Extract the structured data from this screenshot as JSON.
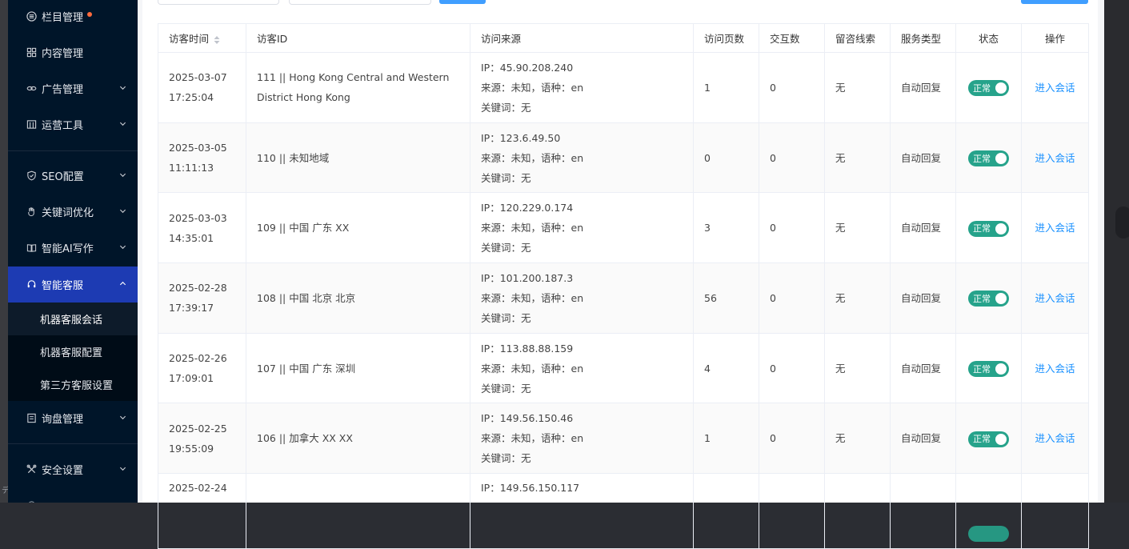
{
  "sidebar": {
    "items": [
      {
        "label": "栏目管理",
        "icon": "list-icon",
        "has_dot": true
      },
      {
        "label": "内容管理",
        "icon": "grid-icon"
      },
      {
        "label": "广告管理",
        "icon": "link-icon"
      },
      {
        "label": "运营工具",
        "icon": "tool-icon"
      },
      {
        "label": "SEO配置",
        "icon": "shield-icon"
      },
      {
        "label": "关键词优化",
        "icon": "hand-icon"
      },
      {
        "label": "智能AI写作",
        "icon": "book-icon"
      },
      {
        "label": "智能客服",
        "icon": "headset-icon"
      },
      {
        "label": "询盘管理",
        "icon": "inbox-icon"
      },
      {
        "label": "安全设置",
        "icon": "wrench-icon"
      }
    ],
    "sub_items": [
      {
        "label": "机器客服会话"
      },
      {
        "label": "机器客服配置"
      },
      {
        "label": "第三方客服设置"
      }
    ]
  },
  "table": {
    "headers": {
      "visit_time": "访客时间",
      "visitor_id": "访客ID",
      "source": "访问来源",
      "pages": "访问页数",
      "interactions": "交互数",
      "leads": "留咨线索",
      "service_type": "服务类型",
      "status": "状态",
      "action": "操作"
    },
    "rows": [
      {
        "date": "2025-03-07",
        "time": "17:25:04",
        "id_line1": "111 || Hong Kong Central and Western",
        "id_line2": "District Hong Kong",
        "ip": "IP：45.90.208.240",
        "from": "来源：未知，语种：en",
        "keyword": "关键词：无",
        "pages": "1",
        "interactions": "0",
        "leads": "无",
        "service": "自动回复",
        "status": "正常",
        "action": "进入会话"
      },
      {
        "date": "2025-03-05",
        "time": "11:11:13",
        "id_line1": "110 || 未知地域",
        "id_line2": "",
        "ip": "IP：123.6.49.50",
        "from": "来源：未知，语种：en",
        "keyword": "关键词：无",
        "pages": "0",
        "interactions": "0",
        "leads": "无",
        "service": "自动回复",
        "status": "正常",
        "action": "进入会话"
      },
      {
        "date": "2025-03-03",
        "time": "14:35:01",
        "id_line1": "109 || 中国 广东 XX",
        "id_line2": "",
        "ip": "IP：120.229.0.174",
        "from": "来源：未知，语种：en",
        "keyword": "关键词：无",
        "pages": "3",
        "interactions": "0",
        "leads": "无",
        "service": "自动回复",
        "status": "正常",
        "action": "进入会话"
      },
      {
        "date": "2025-02-28",
        "time": "17:39:17",
        "id_line1": "108 || 中国 北京 北京",
        "id_line2": "",
        "ip": "IP：101.200.187.3",
        "from": "来源：未知，语种：en",
        "keyword": "关键词：无",
        "pages": "56",
        "interactions": "0",
        "leads": "无",
        "service": "自动回复",
        "status": "正常",
        "action": "进入会话"
      },
      {
        "date": "2025-02-26",
        "time": "17:09:01",
        "id_line1": "107 || 中国 广东 深圳",
        "id_line2": "",
        "ip": "IP：113.88.88.159",
        "from": "来源：未知，语种：en",
        "keyword": "关键词：无",
        "pages": "4",
        "interactions": "0",
        "leads": "无",
        "service": "自动回复",
        "status": "正常",
        "action": "进入会话"
      },
      {
        "date": "2025-02-25",
        "time": "19:55:09",
        "id_line1": "106 || 加拿大 XX XX",
        "id_line2": "",
        "ip": "IP：149.56.150.46",
        "from": "来源：未知，语种：en",
        "keyword": "关键词：无",
        "pages": "1",
        "interactions": "0",
        "leads": "无",
        "service": "自动回复",
        "status": "正常",
        "action": "进入会话"
      },
      {
        "date": "2025-02-24",
        "time": "",
        "id_line1": "",
        "id_line2": "",
        "ip": "IP：149.56.150.117",
        "from": "",
        "keyword": "",
        "pages": "",
        "interactions": "",
        "leads": "",
        "service": "",
        "status": "",
        "action": ""
      }
    ]
  },
  "colors": {
    "sidebar_bg": "#001529",
    "active_menu": "#1d3bb3",
    "link": "#1890ff",
    "switch_on": "#26a38b",
    "dot": "#ff6b3d"
  }
}
